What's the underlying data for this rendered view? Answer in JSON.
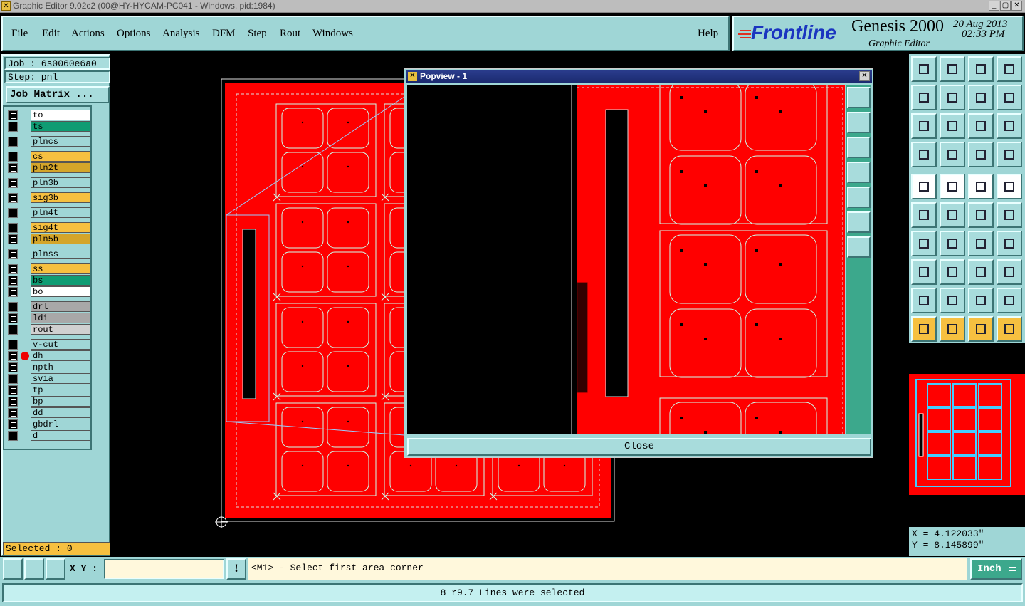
{
  "window": {
    "title": "Graphic Editor 9.02c2 (00@HY-HYCAM-PC041 - Windows, pid:1984)"
  },
  "menu": [
    "File",
    "Edit",
    "Actions",
    "Options",
    "Analysis",
    "DFM",
    "Step",
    "Rout",
    "Windows"
  ],
  "help": "Help",
  "brand": {
    "logo": "Frontline",
    "product": "Genesis 2000",
    "subtitle": "Graphic Editor",
    "date": "20 Aug 2013",
    "time": "02:33 PM"
  },
  "job": {
    "job_line": "Job : 6s0060e6a0",
    "step_line": "Step: pnl",
    "matrix_button": "Job Matrix ..."
  },
  "layers": [
    {
      "name": "to",
      "color": "#ffffff",
      "group": 0
    },
    {
      "name": "ts",
      "color": "#0f9c73",
      "group": 0
    },
    {
      "name": "plncs",
      "color": "#9fd6d6",
      "group": 1
    },
    {
      "name": "cs",
      "color": "#f6c040",
      "group": 2
    },
    {
      "name": "pln2t",
      "color": "#d4a52a",
      "group": 2
    },
    {
      "name": "pln3b",
      "color": "#9fd6d6",
      "group": 3
    },
    {
      "name": "sig3b",
      "color": "#f6c040",
      "group": 4
    },
    {
      "name": "pln4t",
      "color": "#9fd6d6",
      "group": 5
    },
    {
      "name": "sig4t",
      "color": "#f6c040",
      "group": 6
    },
    {
      "name": "pln5b",
      "color": "#d4a52a",
      "group": 6
    },
    {
      "name": "plnss",
      "color": "#9fd6d6",
      "group": 7
    },
    {
      "name": "ss",
      "color": "#f6c040",
      "group": 8
    },
    {
      "name": "bs",
      "color": "#0f9c73",
      "group": 8
    },
    {
      "name": "bo",
      "color": "#ffffff",
      "group": 8
    },
    {
      "name": "drl",
      "color": "#a8a8a8",
      "group": 9
    },
    {
      "name": "ldi",
      "color": "#a8a8a8",
      "group": 9
    },
    {
      "name": "rout",
      "color": "#d0d0d0",
      "group": 9
    },
    {
      "name": "v-cut",
      "color": "#9fd6d6",
      "group": 10
    },
    {
      "name": "dh",
      "color": "#9fd6d6",
      "group": 10
    },
    {
      "name": "npth",
      "color": "#9fd6d6",
      "group": 10
    },
    {
      "name": "svia",
      "color": "#9fd6d6",
      "group": 10
    },
    {
      "name": "tp",
      "color": "#9fd6d6",
      "group": 10
    },
    {
      "name": "bp",
      "color": "#9fd6d6",
      "group": 10
    },
    {
      "name": "dd",
      "color": "#9fd6d6",
      "group": 10
    },
    {
      "name": "gbdrl",
      "color": "#9fd6d6",
      "group": 10
    },
    {
      "name": "d",
      "color": "#9fd6d6",
      "group": 10
    }
  ],
  "selected": "Selected : 0",
  "popview": {
    "title": "Popview - 1",
    "close_label": "Close"
  },
  "coords": {
    "x": "X = 4.122033\"",
    "y": "Y = 8.145899\""
  },
  "xy_label": "X Y :",
  "xy_value": "",
  "prompt": "<M1> - Select first area corner",
  "units": "Inch",
  "status": "8 r9.7 Lines were selected",
  "colors": {
    "board": "#ff0000",
    "ui": "#9fd6d6",
    "highlight": "#f6c040"
  }
}
